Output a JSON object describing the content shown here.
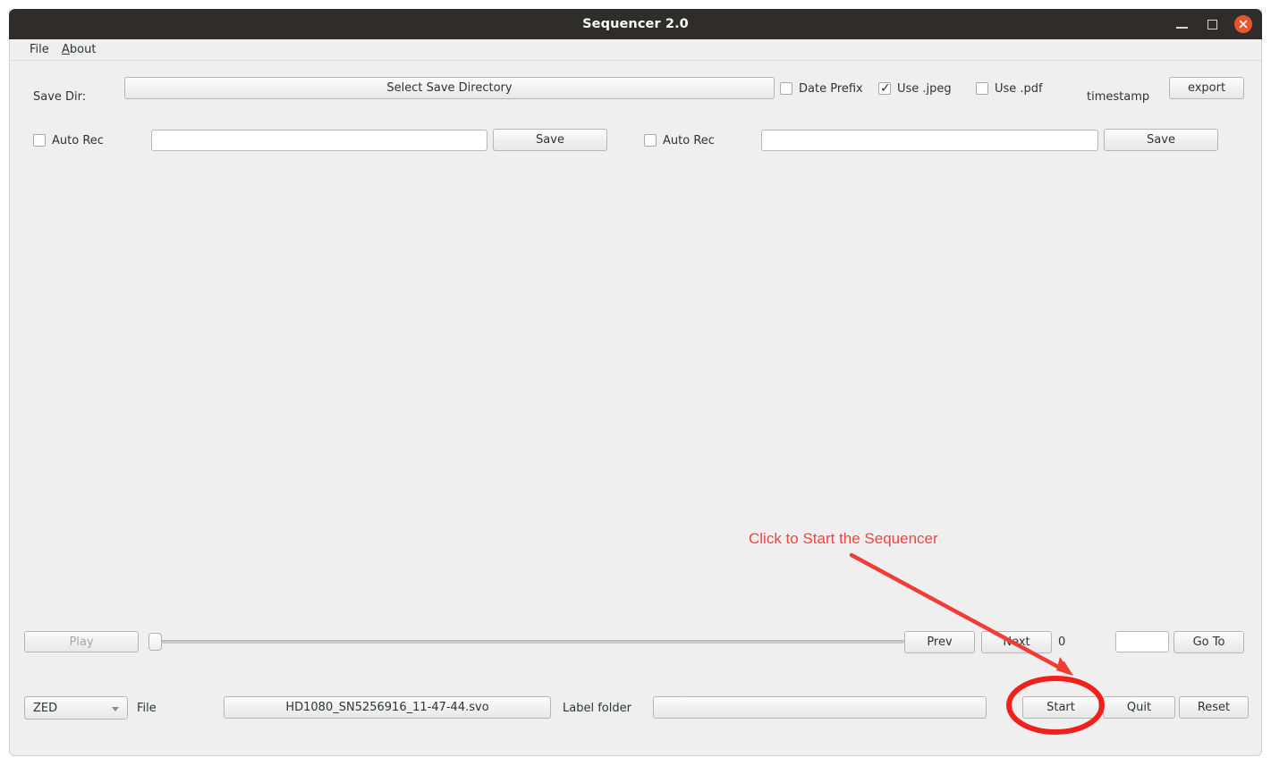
{
  "window": {
    "title": "Sequencer 2.0",
    "controls": {
      "minimize": "minimize",
      "maximize": "maximize",
      "close": "close"
    }
  },
  "menubar": {
    "items": [
      {
        "label": "File"
      },
      {
        "label": "About",
        "mnemonic": "A"
      }
    ]
  },
  "toolbar": {
    "save_dir_label": "Save Dir:",
    "select_save_dir_button": "Select Save Directory",
    "date_prefix": {
      "label": "Date Prefix",
      "checked": false
    },
    "use_jpeg": {
      "label": "Use .jpeg",
      "checked": true
    },
    "use_pdf": {
      "label": "Use .pdf",
      "checked": false
    },
    "timestamp_label": "timestamp",
    "export_button": "export"
  },
  "recorders": [
    {
      "auto_rec_label": "Auto Rec",
      "auto_rec_checked": false,
      "path_value": "",
      "path_placeholder": "",
      "save_button": "Save"
    },
    {
      "auto_rec_label": "Auto Rec",
      "auto_rec_checked": false,
      "path_value": "",
      "path_placeholder": "",
      "save_button": "Save"
    }
  ],
  "playback": {
    "play_button": "Play",
    "play_enabled": false,
    "slider_value": 0,
    "prev_button": "Prev",
    "next_button": "Next",
    "frame_counter": "0",
    "goto_value": "",
    "goto_placeholder": "",
    "goto_button": "Go To"
  },
  "statusbar": {
    "camera_select": "ZED",
    "file_label": "File",
    "file_name": "HD1080_SN5256916_11-47-44.svo",
    "label_folder_label": "Label folder",
    "label_folder_value": "",
    "start_button": "Start",
    "quit_button": "Quit",
    "reset_button": "Reset"
  },
  "annotation": {
    "text": "Click to Start the Sequencer",
    "color": "#f0443c",
    "highlight_target": "Start"
  },
  "colors": {
    "titlebar": "#2f2d2b",
    "window_bg": "#efefef",
    "close_button": "#e9562c",
    "annotation_red": "#f0443c"
  }
}
